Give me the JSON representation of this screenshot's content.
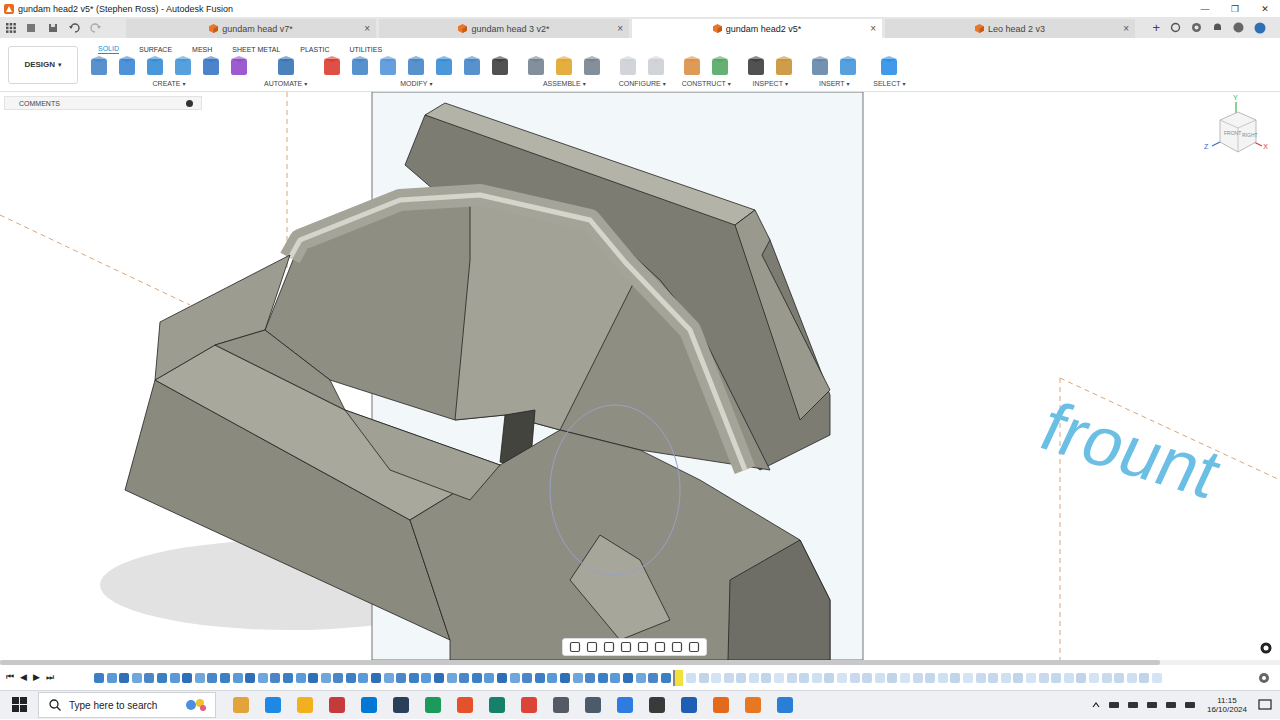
{
  "window": {
    "title": "gundam head2 v5* (Stephen Ross) - Autodesk Fusion",
    "controls": [
      "—",
      "❐",
      "✕"
    ]
  },
  "tabs": [
    {
      "label": "gundam head v7*",
      "selected": false
    },
    {
      "label": "gundam head 3 v2*",
      "selected": false
    },
    {
      "label": "gundam head2 v5*",
      "selected": true
    },
    {
      "label": "Leo head 2 v3",
      "selected": false
    }
  ],
  "tab_close": "×",
  "new_tab": "+",
  "workspace": {
    "label": "DESIGN",
    "caret": "▾"
  },
  "toolbar_tabs": [
    {
      "label": "SOLID",
      "selected": true
    },
    {
      "label": "SURFACE",
      "selected": false
    },
    {
      "label": "MESH",
      "selected": false
    },
    {
      "label": "SHEET METAL",
      "selected": false
    },
    {
      "label": "PLASTIC",
      "selected": false
    },
    {
      "label": "UTILITIES",
      "selected": false
    }
  ],
  "group_caret": "▾",
  "tool_groups": [
    {
      "label": "CREATE"
    },
    {
      "label": "AUTOMATE"
    },
    {
      "label": "MODIFY"
    },
    {
      "label": "ASSEMBLE"
    },
    {
      "label": "CONFIGURE"
    },
    {
      "label": "CONSTRUCT"
    },
    {
      "label": "INSPECT"
    },
    {
      "label": "INSERT"
    },
    {
      "label": "SELECT"
    }
  ],
  "comments": {
    "label": "COMMENTS"
  },
  "viewcube": {
    "faces": [
      "FRONT",
      "RIGHT"
    ],
    "axes": {
      "x": "X",
      "y": "Y",
      "z": "Z"
    }
  },
  "sketch_text": "frount",
  "timeline": {
    "controls": [
      "⏮",
      "◀",
      "▶",
      "⏭"
    ],
    "level": 0.55
  },
  "taskbar": {
    "search_placeholder": "Type here to search",
    "time": "11:15",
    "date": "16/10/2024"
  }
}
